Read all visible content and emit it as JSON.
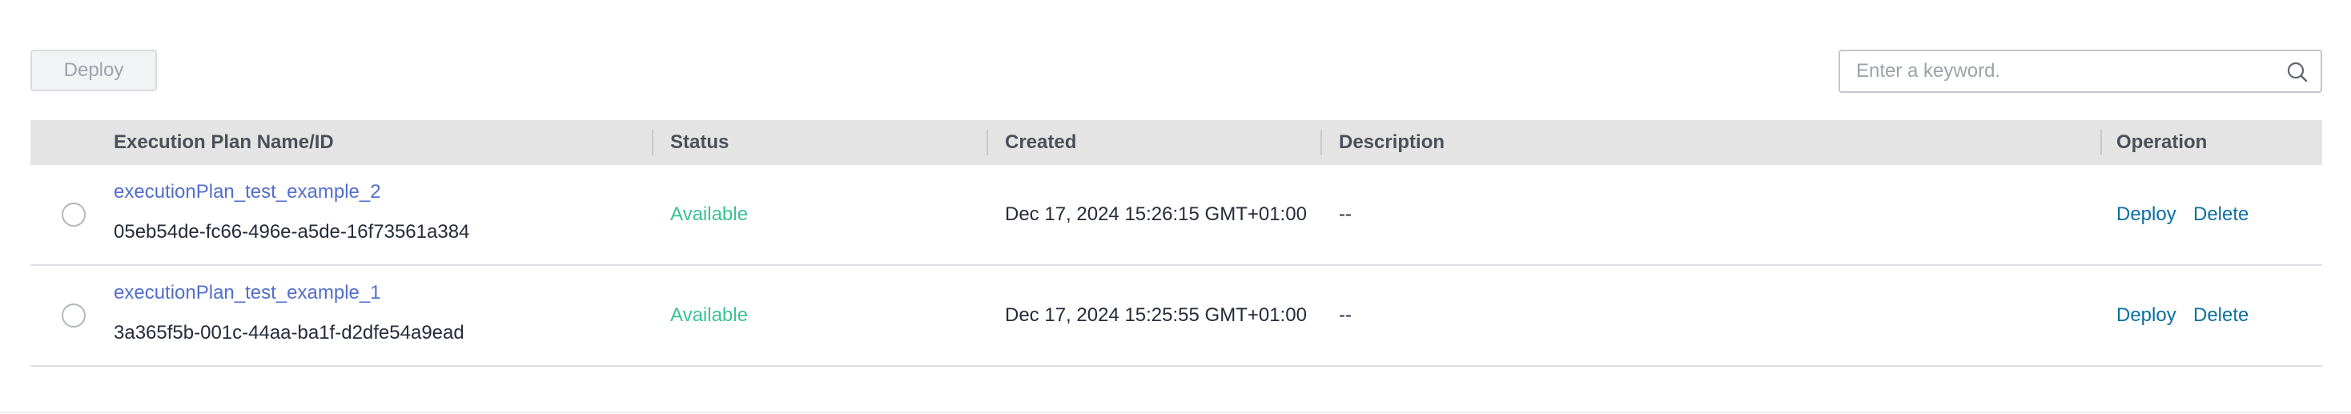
{
  "toolbar": {
    "deploy_label": "Deploy",
    "search_placeholder": "Enter a keyword.",
    "search_value": "",
    "search_icon": "search-icon"
  },
  "table": {
    "columns": [
      "Execution Plan Name/ID",
      "Status",
      "Created",
      "Description",
      "Operation"
    ],
    "rows": [
      {
        "name": "executionPlan_test_example_2",
        "id": "05eb54de-fc66-496e-a5de-16f73561a384",
        "status": "Available",
        "created": "Dec 17, 2024 15:26:15 GMT+01:00",
        "description": "--",
        "op_deploy": "Deploy",
        "op_delete": "Delete"
      },
      {
        "name": "executionPlan_test_example_1",
        "id": "3a365f5b-001c-44aa-ba1f-d2dfe54a9ead",
        "status": "Available",
        "created": "Dec 17, 2024 15:25:55 GMT+01:00",
        "description": "--",
        "op_deploy": "Deploy",
        "op_delete": "Delete"
      }
    ]
  },
  "colors": {
    "link": "#526ecc",
    "operation_link": "#0a6ea0",
    "status_available": "#3ac295",
    "header_bg": "#e4e4e4"
  }
}
